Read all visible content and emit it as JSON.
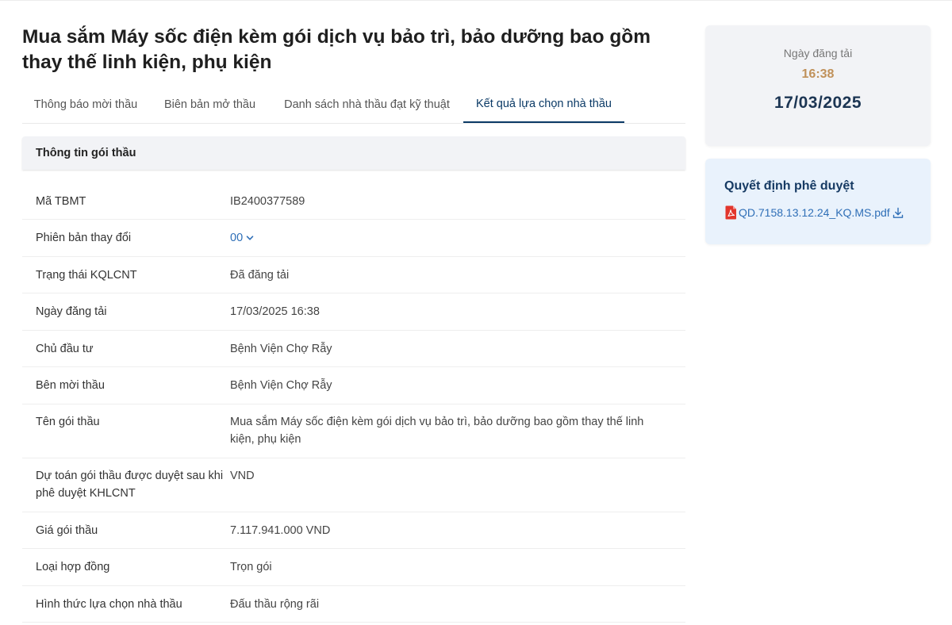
{
  "page": {
    "title": "Mua sắm Máy sốc điện kèm gói dịch vụ bảo trì, bảo dưỡng bao gồm thay thế linh kiện, phụ kiện"
  },
  "tabs": [
    {
      "label": "Thông báo mời thầu"
    },
    {
      "label": "Biên bản mở thầu"
    },
    {
      "label": "Danh sách nhà thầu đạt kỹ thuật"
    },
    {
      "label": "Kết quả lựa chọn nhà thầu",
      "active": true
    }
  ],
  "panel": {
    "title": "Thông tin gói thầu",
    "rows": [
      {
        "label": "Mã TBMT",
        "value": "IB2400377589"
      },
      {
        "label": "Phiên bản thay đổi",
        "value": "00"
      },
      {
        "label": "Trạng thái KQLCNT",
        "value": "Đã đăng tải"
      },
      {
        "label": "Ngày đăng tải",
        "value": "17/03/2025 16:38"
      },
      {
        "label": "Chủ đầu tư",
        "value": "Bệnh Viện Chợ Rẫy"
      },
      {
        "label": "Bên mời thầu",
        "value": "Bệnh Viện Chợ Rẫy"
      },
      {
        "label": "Tên gói thầu",
        "value": "Mua sắm Máy sốc điện kèm gói dịch vụ bảo trì, bảo dưỡng bao gồm thay thế linh kiện, phụ kiện"
      },
      {
        "label": "Dự toán gói thầu được duyệt sau khi phê duyệt KHLCNT",
        "value": "VND"
      },
      {
        "label": "Giá gói thầu",
        "value": "7.117.941.000 VND"
      },
      {
        "label": "Loại hợp đồng",
        "value": "Trọn gói"
      },
      {
        "label": "Hình thức lựa chọn nhà thầu",
        "value": "Đấu thầu rộng rãi"
      }
    ]
  },
  "post_info": {
    "label": "Ngày đăng tải",
    "time": "16:38",
    "date": "17/03/2025"
  },
  "decision": {
    "heading": "Quyết định phê duyệt",
    "file_name": "QD.7158.13.12.24_KQ.MS.pdf"
  },
  "colors": {
    "accent": "#0b3a66",
    "link": "#2f6fb7",
    "time": "#c0915a",
    "pdf": "#e2362d"
  },
  "icons": {
    "version": "chevron-down-icon",
    "file": "pdf-file-icon",
    "download": "download-icon"
  }
}
